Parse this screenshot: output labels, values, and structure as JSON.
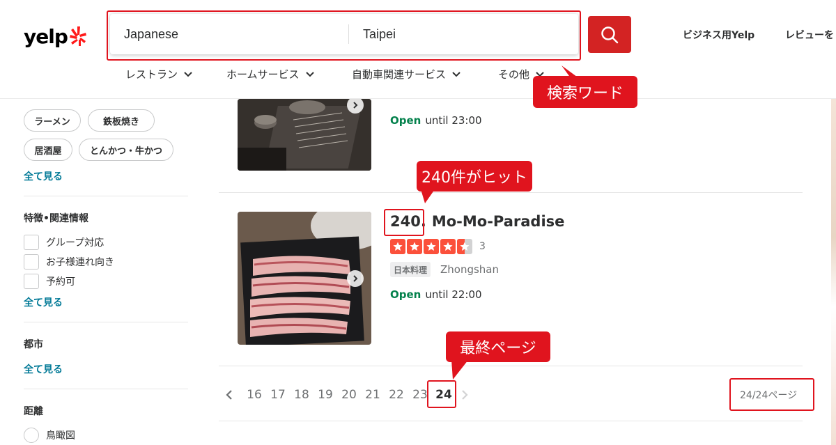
{
  "header": {
    "logo": "yelp",
    "search_what": "Japanese",
    "search_where": "Taipei",
    "links": [
      "ビジネス用Yelp",
      "レビューを"
    ],
    "nav": [
      "レストラン",
      "ホームサービス",
      "自動車関連サービス",
      "その他"
    ]
  },
  "annotations": {
    "search_words": "検索ワード",
    "hits": "240件がヒット",
    "last_page": "最終ページ"
  },
  "sidebar": {
    "chips": [
      "ラーメン",
      "鉄板焼き",
      "居酒屋",
      "とんかつ・牛かつ"
    ],
    "see_all_1": "全て見る",
    "features_title": "特徴•関連情報",
    "features": [
      "グループ対応",
      "お子様連れ向き",
      "予約可"
    ],
    "see_all_2": "全て見る",
    "city_title": "都市",
    "see_all_3": "全て見る",
    "distance_title": "距離",
    "distance_option": "鳥瞰図"
  },
  "results": [
    {
      "open_label": "Open",
      "open_until": "until 23:00"
    },
    {
      "number": "240.",
      "name": "Mo-Mo-Paradise",
      "rating": 4.5,
      "review_count": "3",
      "category": "日本料理",
      "neighborhood": "Zhongshan",
      "open_label": "Open",
      "open_until": "until 22:00"
    }
  ],
  "pagination": {
    "pages": [
      "16",
      "17",
      "18",
      "19",
      "20",
      "21",
      "22",
      "23"
    ],
    "current": "24",
    "page_count": "24/24ページ"
  },
  "colors": {
    "brand_red": "#d32323",
    "annotation_red": "#e0141e",
    "open_green": "#04814c",
    "link_teal": "#027a97",
    "star_orange": "#fb503b"
  }
}
